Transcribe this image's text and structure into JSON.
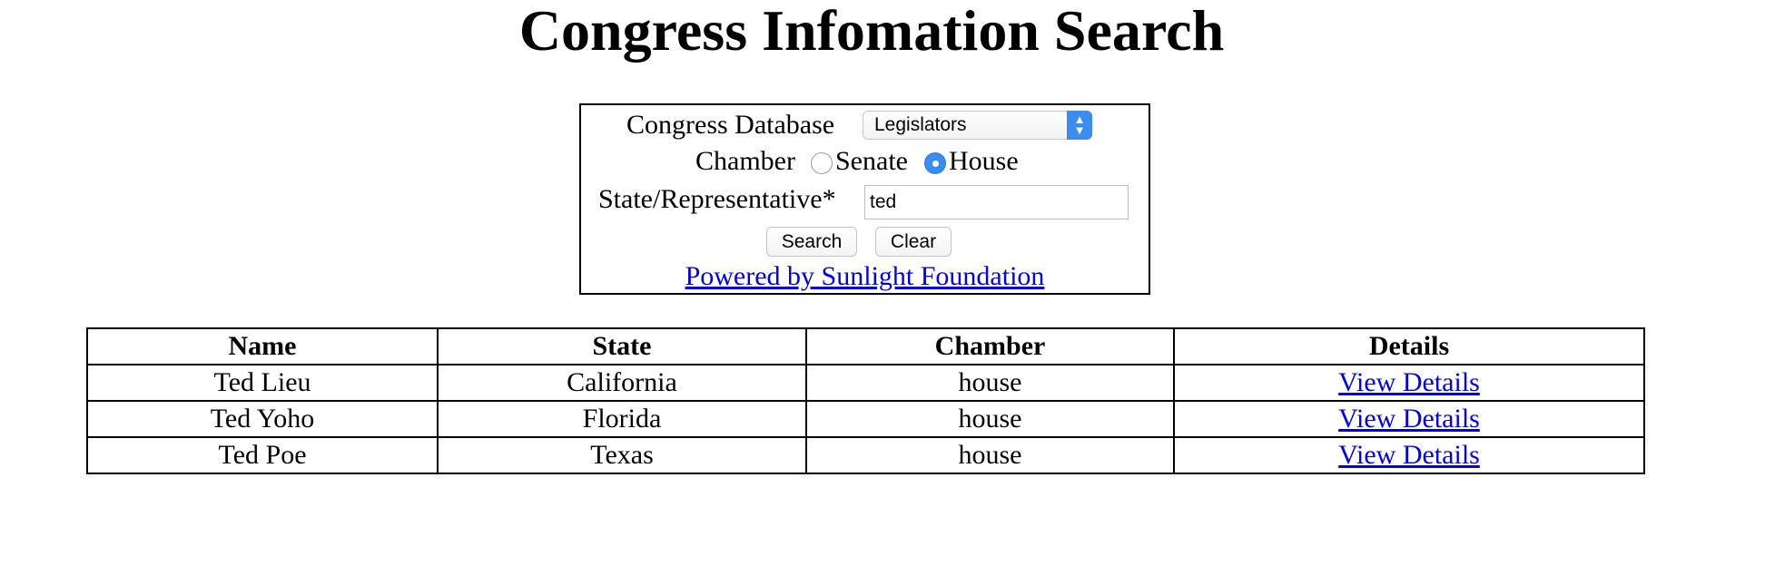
{
  "page": {
    "title": "Congress Infomation Search"
  },
  "form": {
    "database_label": "Congress Database",
    "database_selected": "Legislators",
    "chamber_label": "Chamber",
    "chamber_options": [
      {
        "label": "Senate",
        "checked": false
      },
      {
        "label": "House",
        "checked": true
      }
    ],
    "state_label": "State/Representative*",
    "state_value": "ted",
    "search_button": "Search",
    "clear_button": "Clear",
    "powered_by": "Powered by Sunlight Foundation"
  },
  "table": {
    "headers": [
      "Name",
      "State",
      "Chamber",
      "Details"
    ],
    "rows": [
      {
        "name": "Ted Lieu",
        "state": "California",
        "chamber": "house",
        "details": "View Details"
      },
      {
        "name": "Ted Yoho",
        "state": "Florida",
        "chamber": "house",
        "details": "View Details"
      },
      {
        "name": "Ted Poe",
        "state": "Texas",
        "chamber": "house",
        "details": "View Details"
      }
    ]
  },
  "colors": {
    "link": "#0000ee",
    "accent": "#3b8cf0"
  }
}
